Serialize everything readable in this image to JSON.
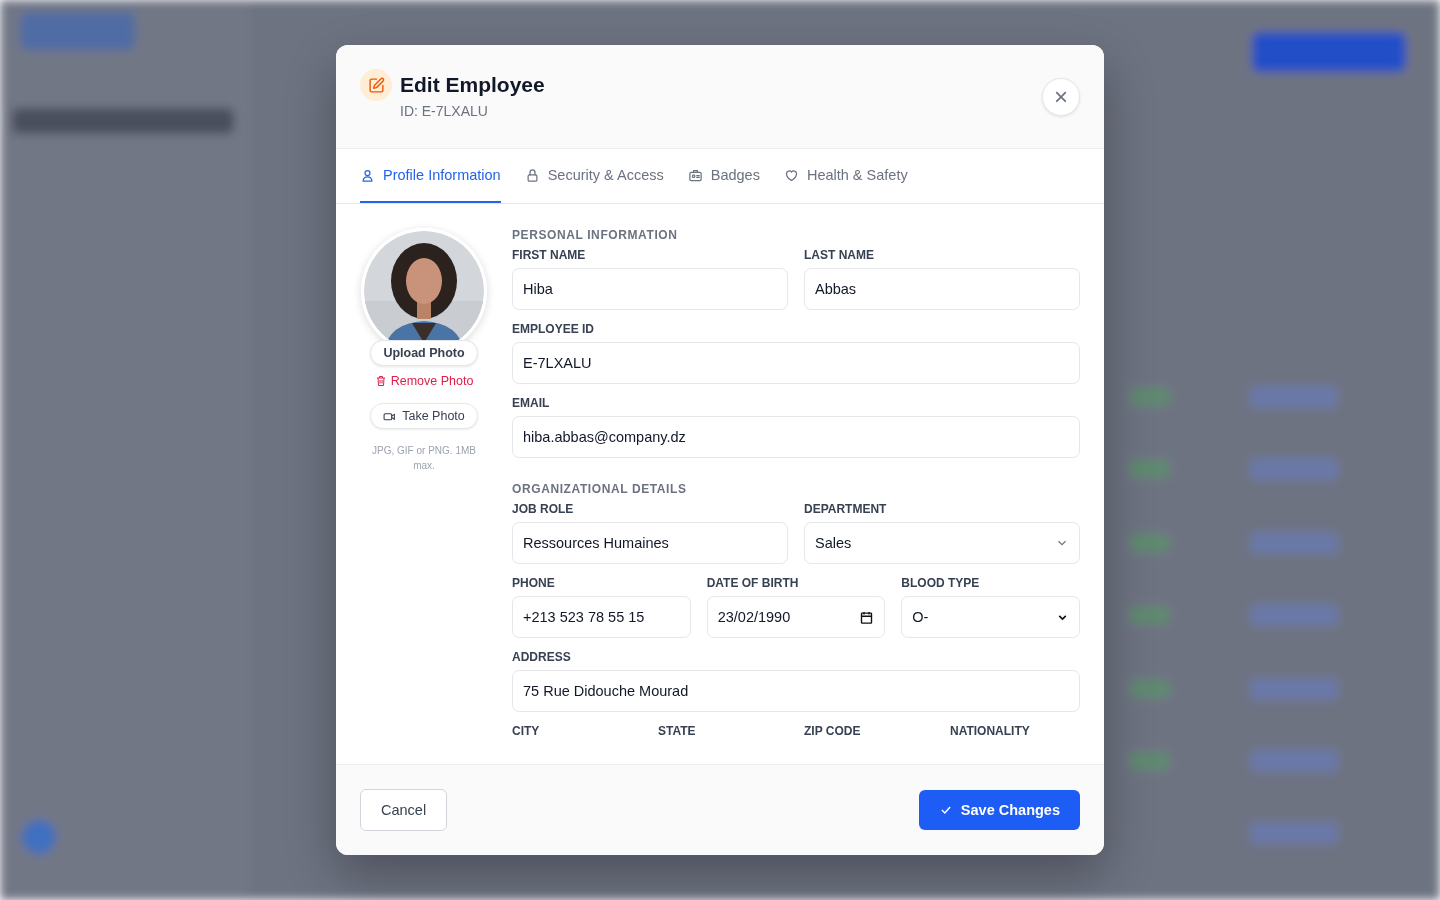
{
  "modal": {
    "title": "Edit Employee",
    "subtitle": "ID: E-7LXALU",
    "close": "×"
  },
  "tabs": [
    {
      "label": "Profile Information",
      "selected": true
    },
    {
      "label": "Security & Access",
      "selected": false
    },
    {
      "label": "Badges",
      "selected": false
    },
    {
      "label": "Health & Safety",
      "selected": false
    }
  ],
  "photo": {
    "upload": "Upload Photo",
    "remove": "Remove Photo",
    "take": "Take Photo",
    "hint": "JPG, GIF or PNG. 1MB max."
  },
  "sections": [
    {
      "title": "PERSONAL INFORMATION",
      "rows": [
        [
          {
            "label": "FIRST NAME",
            "value": "Hiba",
            "kind": "text"
          },
          {
            "label": "LAST NAME",
            "value": "Abbas",
            "kind": "text"
          }
        ],
        [
          {
            "label": "EMPLOYEE ID",
            "value": "E-7LXALU",
            "kind": "text"
          }
        ],
        [
          {
            "label": "EMAIL",
            "value": "hiba.abbas@company.dz",
            "kind": "text"
          }
        ]
      ]
    },
    {
      "title": "ORGANIZATIONAL DETAILS",
      "rows": [
        [
          {
            "label": "JOB ROLE",
            "value": "Ressources Humaines",
            "kind": "text"
          },
          {
            "label": "DEPARTMENT",
            "value": "Sales",
            "kind": "select"
          }
        ],
        [
          {
            "label": "PHONE",
            "value": "+213 523 78 55 15",
            "kind": "text"
          },
          {
            "label": "DATE OF BIRTH",
            "value": "23/02/1990",
            "kind": "date"
          },
          {
            "label": "BLOOD TYPE",
            "value": "O-",
            "kind": "dropdown"
          }
        ],
        [
          {
            "label": "ADDRESS",
            "value": "75 Rue Didouche Mourad",
            "kind": "text"
          }
        ],
        [
          {
            "label": "CITY"
          },
          {
            "label": "STATE"
          },
          {
            "label": "ZIP CODE"
          },
          {
            "label": "NATIONALITY"
          }
        ]
      ]
    }
  ],
  "footer": {
    "cancel": "Cancel",
    "save": "Save Changes"
  }
}
